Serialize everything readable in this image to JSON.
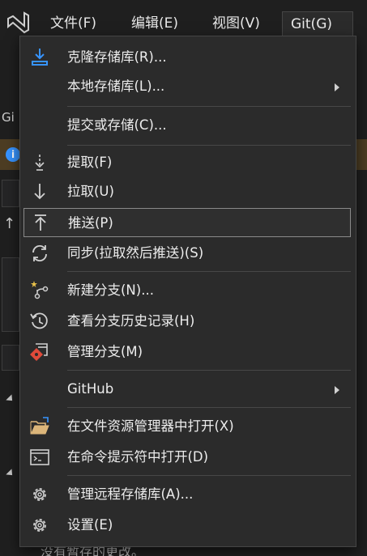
{
  "menubar": {
    "items": [
      {
        "label": "文件(F)"
      },
      {
        "label": "编辑(E)"
      },
      {
        "label": "视图(V)"
      },
      {
        "label": "Git(G)"
      }
    ]
  },
  "background": {
    "left_fragment": "Gi",
    "bottom_text": "没有暂存的更改。"
  },
  "git_menu": {
    "items": [
      {
        "label": "克隆存储库(R)...",
        "icon": "clone-download-icon"
      },
      {
        "label": "本地存储库(L)...",
        "icon": "",
        "submenu": true
      },
      {
        "label": "提交或存储(C)...",
        "icon": ""
      },
      {
        "label": "提取(F)",
        "icon": "fetch-icon"
      },
      {
        "label": "拉取(U)",
        "icon": "pull-icon"
      },
      {
        "label": "推送(P)",
        "icon": "push-icon"
      },
      {
        "label": "同步(拉取然后推送)(S)",
        "icon": "sync-icon"
      },
      {
        "label": "新建分支(N)...",
        "icon": "new-branch-icon"
      },
      {
        "label": "查看分支历史记录(H)",
        "icon": "history-icon"
      },
      {
        "label": "管理分支(M)",
        "icon": "manage-branches-icon"
      },
      {
        "label": "GitHub",
        "icon": "",
        "submenu": true
      },
      {
        "label": "在文件资源管理器中打开(X)",
        "icon": "folder-open-icon"
      },
      {
        "label": "在命令提示符中打开(D)",
        "icon": "terminal-icon"
      },
      {
        "label": "管理远程存储库(A)...",
        "icon": "gear-icon"
      },
      {
        "label": "设置(E)",
        "icon": "gear-icon"
      }
    ]
  },
  "colors": {
    "menu_bg": "#2b2b2b",
    "accent_blue": "#3794ff",
    "branch_red": "#e04a3a",
    "folder_yellow": "#dcb67a"
  }
}
